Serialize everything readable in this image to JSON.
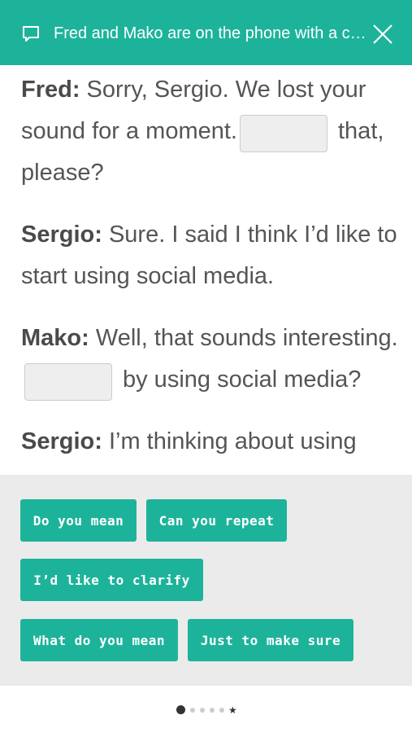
{
  "header": {
    "title": "Fred and Mako are on the phone with a client. Listen and complete the conversation.",
    "icon": "chat-icon",
    "close_icon": "close-icon",
    "background": "#1db39b"
  },
  "dialogue": {
    "l1_speaker": "Fred:",
    "l1_text": " Sorry, Sergio. We lost your",
    "l2_text_a": "sound for a moment.",
    "l2_text_b": "that,",
    "l3_text": "please?",
    "l4_speaker": "Sergio:",
    "l4_text": " Sure. I said I think I’d like to",
    "l5_text": "start using social media.",
    "l6_speaker": "Mako:",
    "l6_text": " Well, that sounds interesting.",
    "l7_text": "by using social media?",
    "l8_speaker": "Sergio:",
    "l8_text": " I’m thinking about using"
  },
  "word_bank": {
    "options": [
      "Do you mean",
      "Can you repeat",
      "I’d like to clarify",
      "What do you mean",
      "Just to make sure"
    ],
    "accent": "#1db39b"
  },
  "pagination": {
    "total_dots": 5,
    "current_index": 0,
    "end_marker": "★"
  }
}
